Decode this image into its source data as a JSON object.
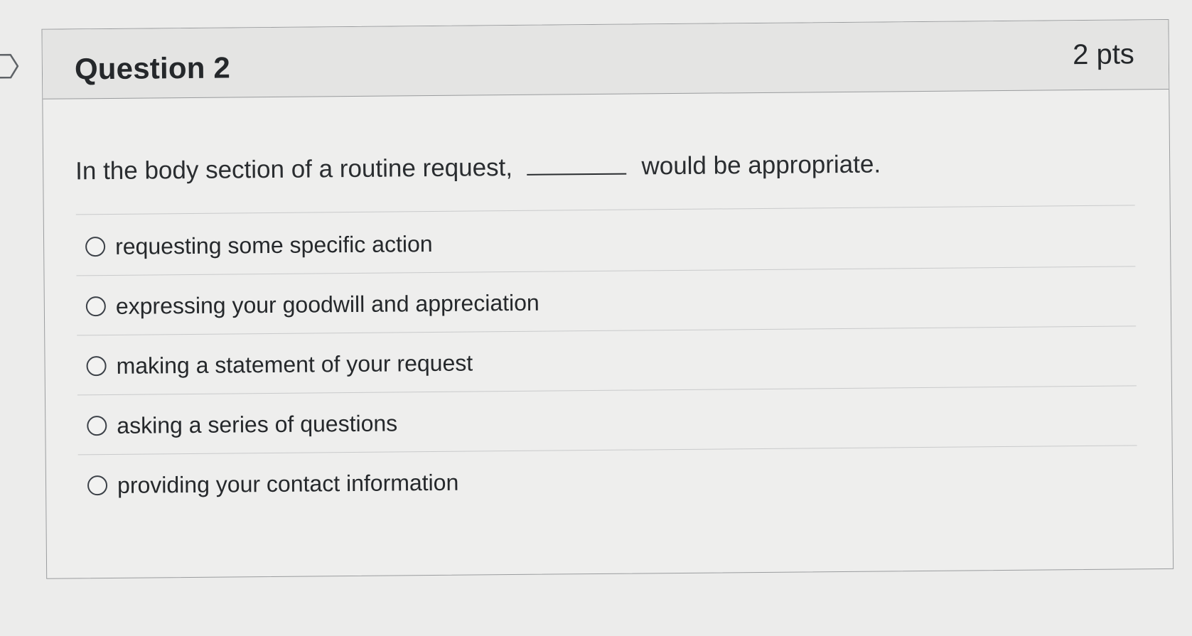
{
  "question": {
    "title": "Question 2",
    "points": "2 pts",
    "text_before_blank": "In the body section of a routine request,",
    "text_after_blank": "would be appropriate."
  },
  "answers": [
    {
      "label": "requesting some specific action",
      "selected": false
    },
    {
      "label": "expressing your goodwill and appreciation",
      "selected": false
    },
    {
      "label": "making a statement of your request",
      "selected": false
    },
    {
      "label": "asking a series of questions",
      "selected": false
    },
    {
      "label": "providing your contact information",
      "selected": false
    }
  ],
  "icons": {
    "flag": "bookmark-flag-icon",
    "answer_marker": "radio-button"
  },
  "colors": {
    "page_background": "#ececeb",
    "header_background": "#e4e4e3",
    "border": "#9a9c9e",
    "text": "#25282b"
  }
}
